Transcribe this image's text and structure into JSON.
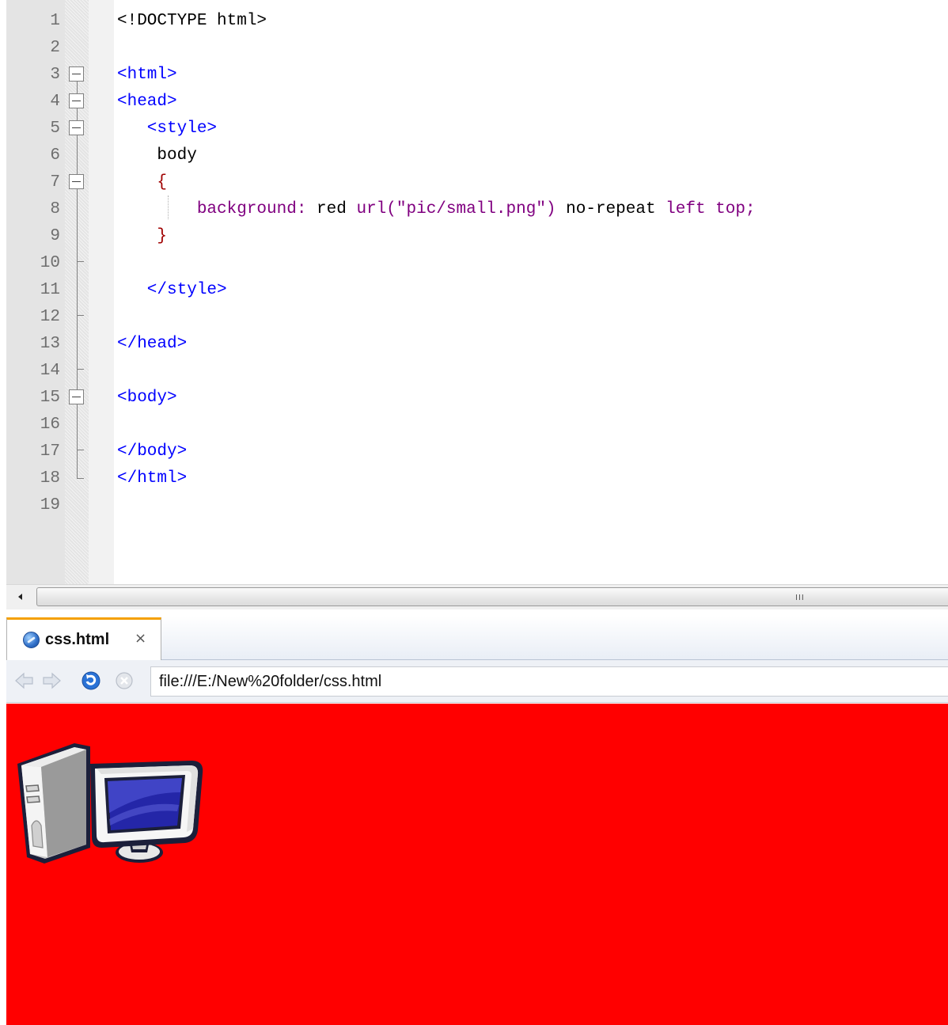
{
  "editor": {
    "lines": [
      {
        "number": "1",
        "parts": [
          {
            "t": "<!DOCTYPE html>",
            "c": "tok-doctype"
          }
        ]
      },
      {
        "number": "2",
        "parts": []
      },
      {
        "number": "3",
        "parts": [
          {
            "t": "<html>",
            "c": "tok-tag"
          }
        ]
      },
      {
        "number": "4",
        "parts": [
          {
            "t": "<head>",
            "c": "tok-tag"
          }
        ]
      },
      {
        "number": "5",
        "parts": [
          {
            "t": "   <style>",
            "c": "tok-tag"
          }
        ]
      },
      {
        "number": "6",
        "parts": [
          {
            "t": "    body",
            "c": "tok-sel"
          }
        ]
      },
      {
        "number": "7",
        "parts": [
          {
            "t": "    {",
            "c": "tok-brace"
          }
        ]
      },
      {
        "number": "8",
        "parts": [
          {
            "t": "        background: ",
            "c": "tok-prop"
          },
          {
            "t": "red ",
            "c": "tok-val"
          },
          {
            "t": "url(",
            "c": "tok-url"
          },
          {
            "t": "\"pic/small.png\"",
            "c": "tok-str"
          },
          {
            "t": ") ",
            "c": "tok-url"
          },
          {
            "t": "no-repeat ",
            "c": "tok-val"
          },
          {
            "t": "left top;",
            "c": "tok-prop"
          }
        ]
      },
      {
        "number": "9",
        "parts": [
          {
            "t": "    }",
            "c": "tok-brace"
          }
        ]
      },
      {
        "number": "10",
        "parts": []
      },
      {
        "number": "11",
        "parts": [
          {
            "t": "   </style>",
            "c": "tok-tag"
          }
        ]
      },
      {
        "number": "12",
        "parts": []
      },
      {
        "number": "13",
        "parts": [
          {
            "t": "</head>",
            "c": "tok-tag"
          }
        ]
      },
      {
        "number": "14",
        "parts": []
      },
      {
        "number": "15",
        "parts": [
          {
            "t": "<body>",
            "c": "tok-tag"
          }
        ]
      },
      {
        "number": "16",
        "parts": []
      },
      {
        "number": "17",
        "parts": [
          {
            "t": "</body>",
            "c": "tok-tag"
          }
        ]
      },
      {
        "number": "18",
        "parts": [
          {
            "t": "</html>",
            "c": "tok-tag"
          }
        ]
      },
      {
        "number": "19",
        "parts": []
      }
    ],
    "colors": {
      "tag": "#0000ff",
      "property": "#800080",
      "brace": "#a00000",
      "text": "#000000",
      "line_number": "#6e6e6e"
    }
  },
  "scrollbar": {
    "grip_label": "III"
  },
  "browser": {
    "tab": {
      "label": "css.html",
      "close_glyph": "×",
      "icon": "browser-globe-icon",
      "accent": "#f5a000"
    },
    "nav_icons": [
      "back-arrow-icon",
      "forward-arrow-icon",
      "reload-icon",
      "stop-icon"
    ],
    "address": "file:///E:/New%20folder/css.html",
    "page": {
      "background": "#ff0000",
      "image": "computer-icon"
    }
  }
}
